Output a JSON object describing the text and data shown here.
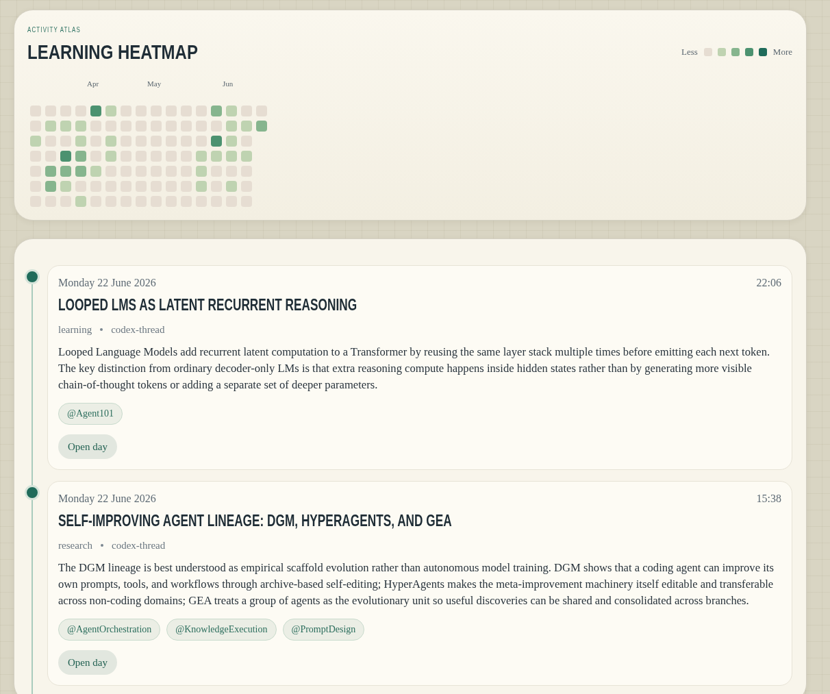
{
  "heatmap": {
    "eyebrow": "ACTIVITY ATLAS",
    "title": "LEARNING HEATMAP",
    "legend": {
      "less": "Less",
      "more": "More",
      "swatches": [
        {
          "color": "#e6ddd2"
        },
        {
          "color": "#bfd3b1"
        },
        {
          "color": "#86b58e"
        },
        {
          "color": "#4c9270"
        },
        {
          "color": "#1f6b5a"
        }
      ]
    },
    "weeks": [
      {
        "days": [
          {
            "color": "#e6ddd2"
          },
          {
            "color": "#e6ddd2"
          },
          {
            "color": "#bfd3b1"
          },
          {
            "color": "#e6ddd2"
          },
          {
            "color": "#e6ddd2"
          },
          {
            "color": "#e6ddd2"
          },
          {
            "color": "#e6ddd2"
          }
        ]
      },
      {
        "days": [
          {
            "color": "#e6ddd2"
          },
          {
            "color": "#bfd3b1"
          },
          {
            "color": "#e6ddd2"
          },
          {
            "color": "#e6ddd2"
          },
          {
            "color": "#86b58e"
          },
          {
            "color": "#86b58e"
          },
          {
            "color": "#e6ddd2"
          }
        ]
      },
      {
        "days": [
          {
            "color": "#e6ddd2"
          },
          {
            "color": "#bfd3b1"
          },
          {
            "color": "#e6ddd2"
          },
          {
            "color": "#4c9270"
          },
          {
            "color": "#86b58e"
          },
          {
            "color": "#bfd3b1"
          },
          {
            "color": "#e6ddd2"
          }
        ]
      },
      {
        "days": [
          {
            "color": "#e6ddd2"
          },
          {
            "color": "#bfd3b1"
          },
          {
            "color": "#bfd3b1"
          },
          {
            "color": "#86b58e"
          },
          {
            "color": "#86b58e"
          },
          {
            "color": "#e6ddd2"
          },
          {
            "color": "#bfd3b1"
          }
        ]
      },
      {
        "month": "Apr",
        "days": [
          {
            "color": "#4c9270"
          },
          {
            "color": "#e6ddd2"
          },
          {
            "color": "#e6ddd2"
          },
          {
            "color": "#e6ddd2"
          },
          {
            "color": "#bfd3b1"
          },
          {
            "color": "#e6ddd2"
          },
          {
            "color": "#e6ddd2"
          }
        ]
      },
      {
        "days": [
          {
            "color": "#bfd3b1"
          },
          {
            "color": "#e6ddd2"
          },
          {
            "color": "#bfd3b1"
          },
          {
            "color": "#bfd3b1"
          },
          {
            "color": "#e6ddd2"
          },
          {
            "color": "#e6ddd2"
          },
          {
            "color": "#e6ddd2"
          }
        ]
      },
      {
        "days": [
          {
            "color": "#e6ddd2"
          },
          {
            "color": "#e6ddd2"
          },
          {
            "color": "#e6ddd2"
          },
          {
            "color": "#e6ddd2"
          },
          {
            "color": "#e6ddd2"
          },
          {
            "color": "#e6ddd2"
          },
          {
            "color": "#e6ddd2"
          }
        ]
      },
      {
        "days": [
          {
            "color": "#e6ddd2"
          },
          {
            "color": "#e6ddd2"
          },
          {
            "color": "#e6ddd2"
          },
          {
            "color": "#e6ddd2"
          },
          {
            "color": "#e6ddd2"
          },
          {
            "color": "#e6ddd2"
          },
          {
            "color": "#e6ddd2"
          }
        ]
      },
      {
        "month": "May",
        "days": [
          {
            "color": "#e6ddd2"
          },
          {
            "color": "#e6ddd2"
          },
          {
            "color": "#e6ddd2"
          },
          {
            "color": "#e6ddd2"
          },
          {
            "color": "#e6ddd2"
          },
          {
            "color": "#e6ddd2"
          },
          {
            "color": "#e6ddd2"
          }
        ]
      },
      {
        "days": [
          {
            "color": "#e6ddd2"
          },
          {
            "color": "#e6ddd2"
          },
          {
            "color": "#e6ddd2"
          },
          {
            "color": "#e6ddd2"
          },
          {
            "color": "#e6ddd2"
          },
          {
            "color": "#e6ddd2"
          },
          {
            "color": "#e6ddd2"
          }
        ]
      },
      {
        "days": [
          {
            "color": "#e6ddd2"
          },
          {
            "color": "#e6ddd2"
          },
          {
            "color": "#e6ddd2"
          },
          {
            "color": "#e6ddd2"
          },
          {
            "color": "#e6ddd2"
          },
          {
            "color": "#e6ddd2"
          },
          {
            "color": "#e6ddd2"
          }
        ]
      },
      {
        "days": [
          {
            "color": "#e6ddd2"
          },
          {
            "color": "#e6ddd2"
          },
          {
            "color": "#e6ddd2"
          },
          {
            "color": "#bfd3b1"
          },
          {
            "color": "#bfd3b1"
          },
          {
            "color": "#bfd3b1"
          },
          {
            "color": "#e6ddd2"
          }
        ]
      },
      {
        "days": [
          {
            "color": "#86b58e"
          },
          {
            "color": "#e6ddd2"
          },
          {
            "color": "#4c9270"
          },
          {
            "color": "#bfd3b1"
          },
          {
            "color": "#e6ddd2"
          },
          {
            "color": "#e6ddd2"
          },
          {
            "color": "#e6ddd2"
          }
        ]
      },
      {
        "month": "Jun",
        "days": [
          {
            "color": "#bfd3b1"
          },
          {
            "color": "#bfd3b1"
          },
          {
            "color": "#bfd3b1"
          },
          {
            "color": "#bfd3b1"
          },
          {
            "color": "#e6ddd2"
          },
          {
            "color": "#bfd3b1"
          },
          {
            "color": "#e6ddd2"
          }
        ]
      },
      {
        "days": [
          {
            "color": "#e6ddd2"
          },
          {
            "color": "#bfd3b1"
          },
          {
            "color": "#e6ddd2"
          },
          {
            "color": "#bfd3b1"
          },
          {
            "color": "#e6ddd2"
          },
          {
            "color": "#e6ddd2"
          },
          {
            "color": "#e6ddd2"
          }
        ]
      },
      {
        "days": [
          {
            "color": "#e6ddd2"
          },
          {
            "color": "#86b58e"
          }
        ]
      }
    ]
  },
  "entries": [
    {
      "date": "Monday 22 June 2026",
      "time": "22:06",
      "title": "LOOPED LMS AS LATENT RECURRENT REASONING",
      "meta": [
        "learning",
        "codex-thread"
      ],
      "summary": "Looped Language Models add recurrent latent computation to a Transformer by reusing the same layer stack multiple times before emitting each next token. The key distinction from ordinary decoder-only LMs is that extra reasoning compute happens inside hidden states rather than by generating more visible chain-of-thought tokens or adding a separate set of deeper parameters.",
      "mentions": [
        "@Agent101"
      ],
      "action": "Open day"
    },
    {
      "date": "Monday 22 June 2026",
      "time": "15:38",
      "title": "SELF-IMPROVING AGENT LINEAGE: DGM, HYPERAGENTS, AND GEA",
      "meta": [
        "research",
        "codex-thread"
      ],
      "summary": "The DGM lineage is best understood as empirical scaffold evolution rather than autonomous model training. DGM shows that a coding agent can improve its own prompts, tools, and workflows through archive-based self-editing; HyperAgents makes the meta-improvement machinery itself editable and transferable across non-coding domains; GEA treats a group of agents as the evolutionary unit so useful discoveries can be shared and consolidated across branches.",
      "mentions": [
        "@AgentOrchestration",
        "@KnowledgeExecution",
        "@PromptDesign"
      ],
      "action": "Open day"
    }
  ]
}
